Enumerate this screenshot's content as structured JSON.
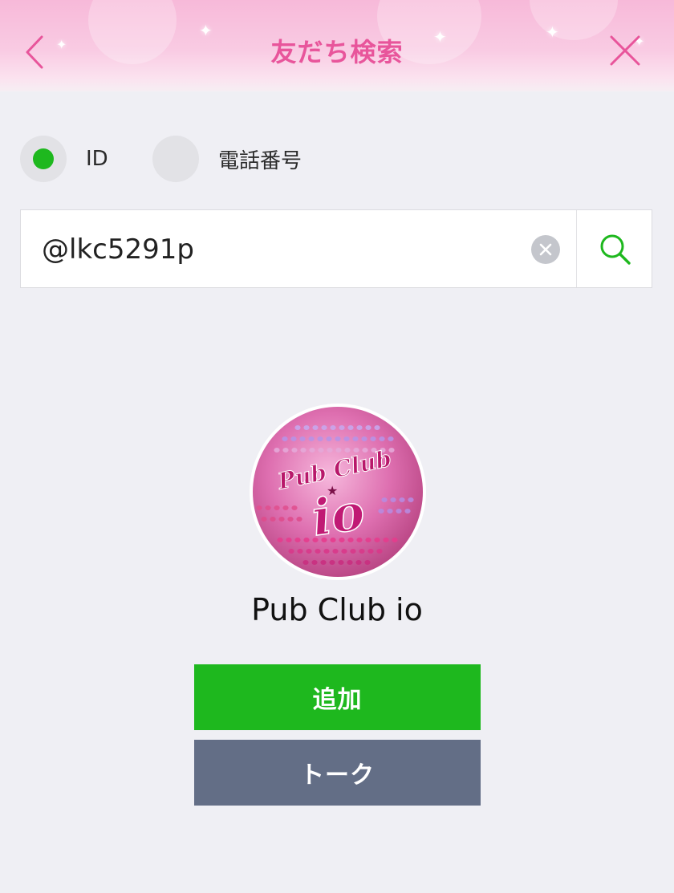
{
  "header": {
    "title": "友だち検索",
    "accent_color": "#e8559b"
  },
  "search_type": {
    "options": [
      {
        "label": "ID",
        "selected": true
      },
      {
        "label": "電話番号",
        "selected": false
      }
    ],
    "selected_color": "#1eb81e"
  },
  "search": {
    "value": "@lkc5291p",
    "clear_icon": "clear-icon",
    "search_icon": "search-icon"
  },
  "result": {
    "name": "Pub Club io",
    "avatar_text": {
      "line1": "Pub Club",
      "line2": "io"
    },
    "add_label": "追加",
    "talk_label": "トーク",
    "add_color": "#1eb81e",
    "talk_color": "#636e86"
  }
}
